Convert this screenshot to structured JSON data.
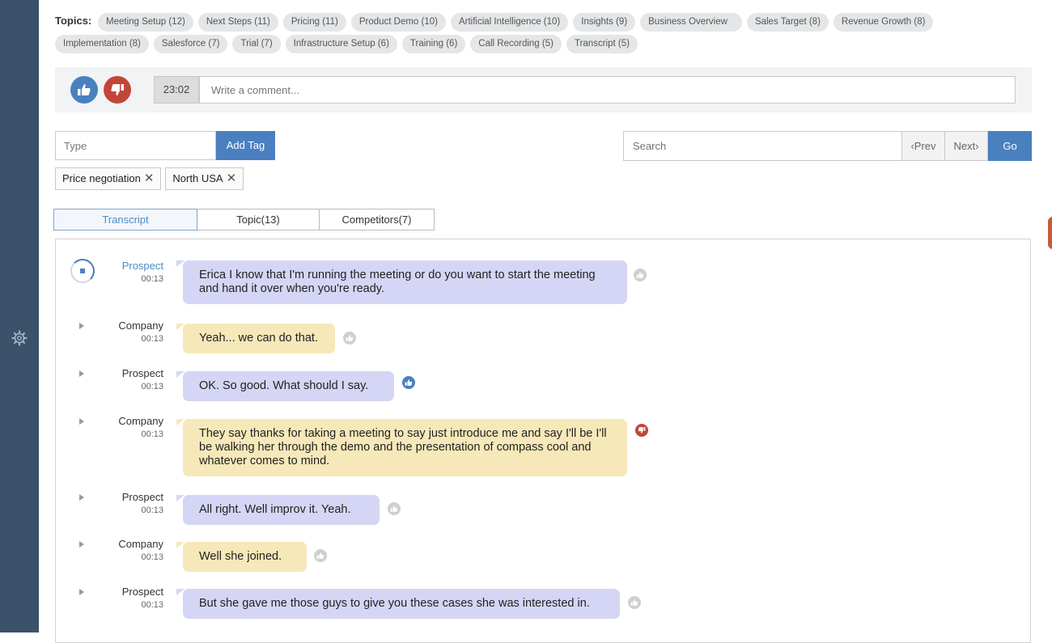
{
  "topics": {
    "label": "Topics:",
    "items": [
      "Meeting Setup (12)",
      "Next Steps (11)",
      "Pricing (11)",
      "Product Demo (10)",
      "Artificial Intelligence (10)",
      "Insights (9)",
      "Business Overview",
      "Sales Target (8)",
      "Revenue Growth (8)",
      "Implementation (8)",
      "Salesforce (7)",
      "Trial (7)",
      "Infrastructure Setup (6)",
      "Training (6)",
      "Call Recording (5)",
      "Transcript (5)"
    ]
  },
  "comment": {
    "time": "23:02",
    "placeholder": "Write a comment..."
  },
  "tagging": {
    "input_placeholder": "Type",
    "add_label": "Add Tag",
    "tags": [
      "Price negotiation",
      "North USA"
    ]
  },
  "search": {
    "placeholder": "Search",
    "prev_label": "Prev",
    "next_label": "Next",
    "go_label": "Go"
  },
  "tabs": [
    "Transcript",
    "Topic(13)",
    "Competitors(7)"
  ],
  "transcript": [
    {
      "speaker": "Prospect",
      "time": "00:13",
      "text": "Erica I know that I'm running the meeting or do you want to start the meeting  and hand it over when you're ready.",
      "reaction": "neutral",
      "playing": true
    },
    {
      "speaker": "Company",
      "time": "00:13",
      "text": "Yeah... we can do that.",
      "reaction": "neutral"
    },
    {
      "speaker": "Prospect",
      "time": "00:13",
      "text": "OK. So good. What should I say.",
      "reaction": "like"
    },
    {
      "speaker": "Company",
      "time": "00:13",
      "text": "They say thanks for taking a meeting to say just introduce me and say I'll be I'll be walking her through the demo and the presentation of compass cool and whatever comes to mind.",
      "reaction": "dislike"
    },
    {
      "speaker": "Prospect",
      "time": "00:13",
      "text": "All right. Well improv it. Yeah.",
      "reaction": "neutral"
    },
    {
      "speaker": "Company",
      "time": "00:13",
      "text": "Well she joined.",
      "reaction": "neutral"
    },
    {
      "speaker": "Prospect",
      "time": "00:13",
      "text": "But she gave me those guys to give you these cases she was interested in.",
      "reaction": "neutral"
    }
  ],
  "colors": {
    "sidebar": "#3b526b",
    "accent": "#4a80c0",
    "dislike": "#c1463a",
    "prospect_bubble": "#d5d6f5",
    "company_bubble": "#f6e8b9"
  }
}
